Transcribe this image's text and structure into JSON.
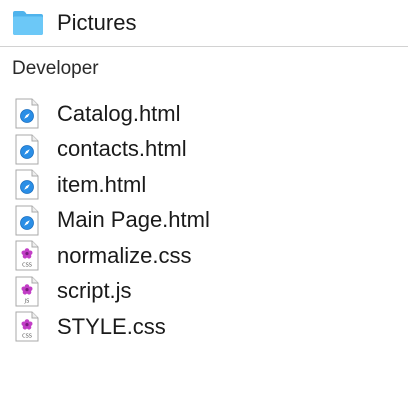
{
  "folder": {
    "name": "Pictures",
    "icon": "folder-icon",
    "color": "#62c3f5"
  },
  "section": {
    "title": "Developer"
  },
  "files": [
    {
      "name": "Catalog.html",
      "icon": "html-file-icon"
    },
    {
      "name": "contacts.html",
      "icon": "html-file-icon"
    },
    {
      "name": "item.html",
      "icon": "html-file-icon"
    },
    {
      "name": "Main Page.html",
      "icon": "html-file-icon"
    },
    {
      "name": "normalize.css",
      "icon": "css-file-icon",
      "badge": "CSS"
    },
    {
      "name": "script.js",
      "icon": "js-file-icon",
      "badge": "JS"
    },
    {
      "name": "STYLE.css",
      "icon": "css-file-icon",
      "badge": "CSS"
    }
  ],
  "colors": {
    "html_icon_accent": "#2a8ee6",
    "css_js_icon_accent": "#c23ec6",
    "divider": "#d2d2d2"
  }
}
